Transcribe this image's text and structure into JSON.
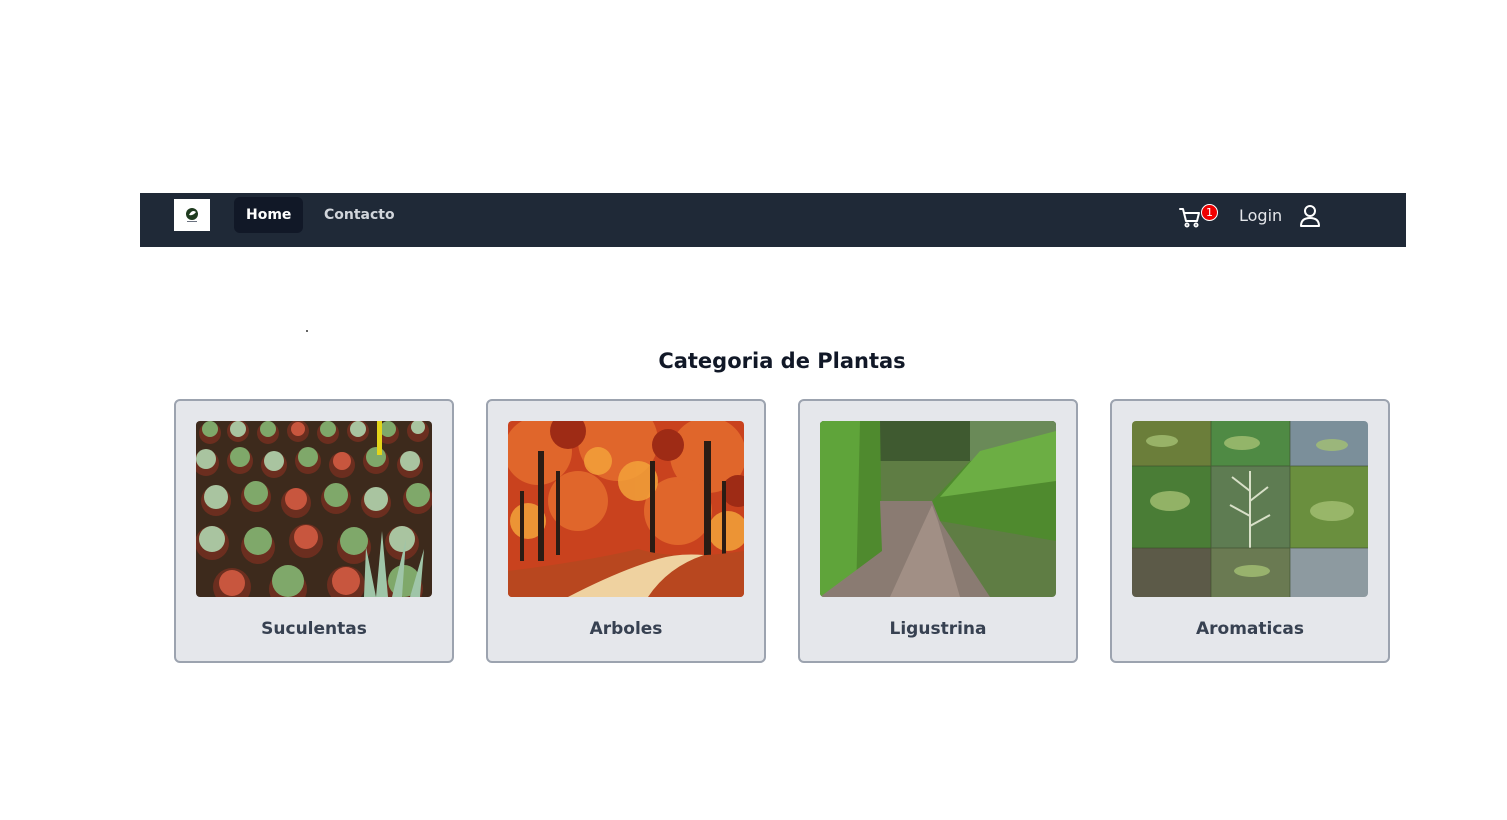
{
  "nav": {
    "items": [
      {
        "label": "Home",
        "active": true
      },
      {
        "label": "Contacto",
        "active": false
      }
    ],
    "cart_count": "1",
    "login_label": "Login"
  },
  "main": {
    "title": "Categoria de Plantas",
    "categories": [
      {
        "label": "Suculentas"
      },
      {
        "label": "Arboles"
      },
      {
        "label": "Ligustrina"
      },
      {
        "label": "Aromaticas"
      }
    ]
  },
  "colors": {
    "navbar_bg": "#1f2937",
    "active_item_bg": "#111827",
    "badge_red": "#ef0000",
    "card_bg": "#e5e7eb",
    "card_border": "#9ca3af"
  }
}
